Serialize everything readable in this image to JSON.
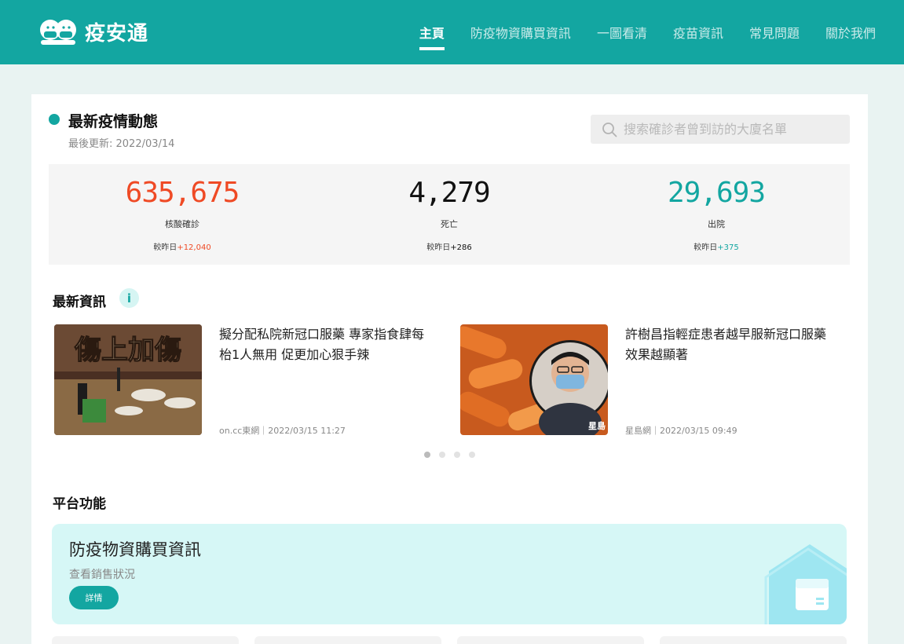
{
  "header": {
    "logo_text": "疫安通",
    "nav": [
      {
        "label": "主頁",
        "active": true
      },
      {
        "label": "防疫物資購買資訊",
        "active": false
      },
      {
        "label": "一圖看清",
        "active": false
      },
      {
        "label": "疫苗資訊",
        "active": false
      },
      {
        "label": "常見問題",
        "active": false
      },
      {
        "label": "關於我們",
        "active": false
      }
    ]
  },
  "status": {
    "title": "最新疫情動態",
    "updated": "最後更新: 2022/03/14",
    "search_placeholder": "搜索確診者曾到訪的大廈名單"
  },
  "stats": [
    {
      "value": "635,675",
      "label": "核酸確診",
      "delta_prefix": "較昨日",
      "delta": "+12,040",
      "color": "#ef4a25"
    },
    {
      "value": "4,279",
      "label": "死亡",
      "delta_prefix": "較昨日",
      "delta": "+286",
      "color": "#111111"
    },
    {
      "value": "29,693",
      "label": "出院",
      "delta_prefix": "較昨日",
      "delta": "+375",
      "color": "#13a6a1"
    }
  ],
  "news": {
    "title": "最新資訊",
    "info_icon": "i",
    "items": [
      {
        "headline": "擬分配私院新冠口服藥 專家指食肆每枱1人無用 促更加心狠手辣",
        "meta": "on.cc東網｜2022/03/15 11:27",
        "image_caption": "傷上加傷"
      },
      {
        "headline": "許樹昌指輕症患者越早服新冠口服藥 效果越顯著",
        "meta": "星島網｜2022/03/15 09:49",
        "image_caption": "星島"
      }
    ],
    "pager_count": 4,
    "pager_active": 0
  },
  "platform": {
    "title": "平台功能",
    "feature": {
      "title": "防疫物資購買資訊",
      "subtitle": "查看銷售狀況",
      "button": "詳情"
    }
  }
}
